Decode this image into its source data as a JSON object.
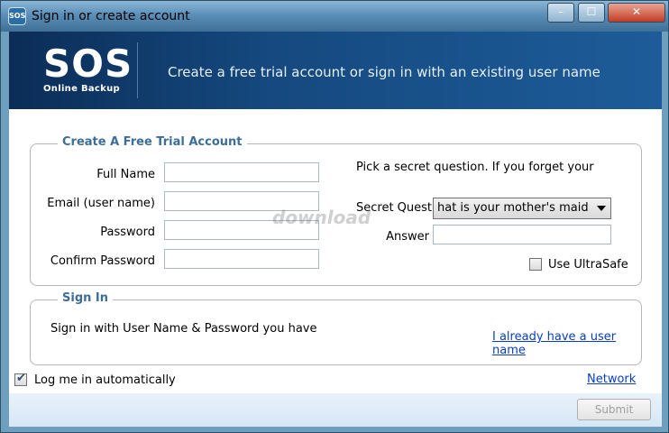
{
  "window": {
    "title": "Sign in or create account",
    "icon_text": "SOS",
    "controls": {
      "minimize": "–",
      "maximize": "☐",
      "close": "✕"
    }
  },
  "header": {
    "logo_main": "SOS",
    "logo_sub": "Online Backup",
    "tagline": "Create a free trial account or sign in with an existing user name"
  },
  "trial": {
    "legend": "Create A Free  Trial Account",
    "full_name_label": "Full Name",
    "email_label": "Email (user name)",
    "password_label": "Password",
    "confirm_label": "Confirm Password",
    "full_name_value": "",
    "email_value": "",
    "password_value": "",
    "confirm_value": "",
    "secret_prompt": "Pick a secret question. If you forget your",
    "secret_question_label": "Secret Question",
    "secret_question_value": "hat is your mother's maid",
    "answer_label": "Answer",
    "answer_value": "",
    "ultrasafe_label": "Use UltraSafe",
    "ultrasafe_checked": false
  },
  "signin": {
    "legend": "Sign In",
    "text": "Sign in with User Name & Password you have",
    "link": "I already have a user name"
  },
  "footer": {
    "auto_login_label": "Log me in automatically",
    "auto_login_checked": true,
    "network_link": "Network",
    "submit_label": "Submit"
  },
  "watermark": "download"
}
